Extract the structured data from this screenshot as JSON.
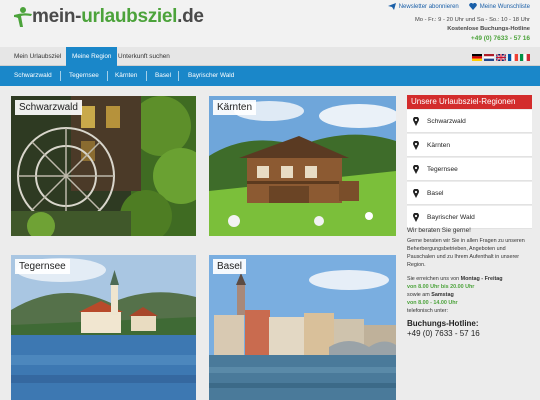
{
  "header": {
    "logo_text_1": "mein-",
    "logo_text_2": "urlaubsziel",
    "logo_text_3": ".de",
    "newsletter_label": "Newsletter abonnieren",
    "wishlist_label": "Meine Wunschliste",
    "hours_line": "Mo - Fr.: 9 - 20 Uhr und Sa - So.: 10 - 18 Uhr",
    "hotline_label": "Kostenlose Buchungs-Hotline",
    "hotline_number": "+49 (0) 7633 - 57 16"
  },
  "nav": {
    "tabs": [
      "Mein Urlaubsziel",
      "Meine Region",
      "Unterkunft suchen"
    ],
    "active_index": 1
  },
  "subnav": {
    "items": [
      "Schwarzwald",
      "Tegernsee",
      "Kärnten",
      "Basel",
      "Bayrischer Wald"
    ]
  },
  "tiles": [
    {
      "label": "Schwarzwald"
    },
    {
      "label": "Kärnten"
    },
    {
      "label": "Tegernsee"
    },
    {
      "label": "Basel"
    }
  ],
  "sidebar": {
    "title": "Unsere Urlaubsziel-Regionen",
    "regions": [
      "Schwarzwald",
      "Kärnten",
      "Tegernsee",
      "Basel",
      "Bayrischer Wald"
    ],
    "advice_title": "Wir beraten Sie gerne!",
    "advice_text": "Gerne beraten wir Sie in allen Fragen zu unseren Beherbergungsbetrieben, Angeboten und Pauschalen und zu Ihrem Aufenthalt in unserer Region.",
    "reach_1": "Sie erreichen uns von",
    "reach_days1": "Montag - Freitag",
    "reach_time1": "von 8.00 Uhr bis 20.00 Uhr",
    "reach_2": "sowie am",
    "reach_days2": "Samstag",
    "reach_time2": "von 8.00 - 14.00 Uhr",
    "reach_3": "telefonisch unter:",
    "hotline_heading": "Buchungs-Hotline:",
    "hotline_number": "+49 (0) 7633 - 57 16"
  },
  "colors": {
    "brand_blue": "#1a87c9",
    "brand_green": "#4ca33b",
    "accent_red": "#d32c2c"
  }
}
